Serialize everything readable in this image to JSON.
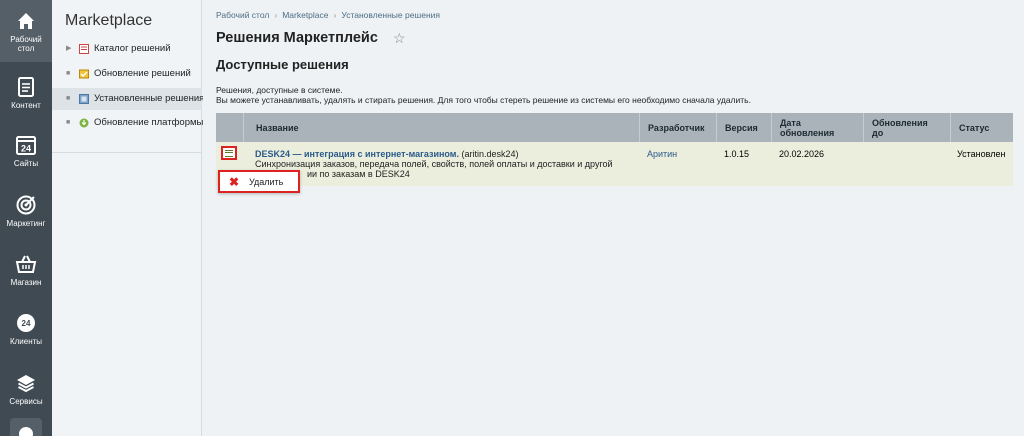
{
  "rail": {
    "items": [
      {
        "label": "Рабочий стол",
        "icon": "home-icon"
      },
      {
        "label": "Контент",
        "icon": "document-icon"
      },
      {
        "label": "Сайты",
        "icon": "calendar-24-icon"
      },
      {
        "label": "Маркетинг",
        "icon": "target-icon"
      },
      {
        "label": "Магазин",
        "icon": "basket-icon"
      },
      {
        "label": "Клиенты",
        "icon": "clients-24-icon"
      },
      {
        "label": "Сервисы",
        "icon": "layers-icon"
      }
    ],
    "icon_24": "24"
  },
  "sidebar": {
    "title": "Marketplace",
    "items": [
      {
        "label": "Каталог решений",
        "icon": "catalog-icon"
      },
      {
        "label": "Обновление решений",
        "icon": "update-icon"
      },
      {
        "label": "Установленные решения",
        "icon": "installed-icon",
        "active": true
      },
      {
        "label": "Обновление платформы",
        "icon": "platform-update-icon"
      }
    ]
  },
  "breadcrumbs": [
    "Рабочий стол",
    "Marketplace",
    "Установленные решения"
  ],
  "page": {
    "title": "Решения Маркетплейс",
    "subtitle": "Доступные решения",
    "desc_line1": "Решения, доступные в системе.",
    "desc_line2": "Вы можете устанавливать, удалять и стирать решения. Для того чтобы стереть решение из системы его необходимо сначала удалить."
  },
  "table": {
    "headers": {
      "name": "Название",
      "developer": "Разработчик",
      "version": "Версия",
      "date_l1": "Дата",
      "date_l2": "обновления",
      "updates_l1": "Обновления",
      "updates_l2": "до",
      "status": "Статус"
    },
    "rows": [
      {
        "name": "DESK24 — интеграция с интернет-магазином.",
        "code": "(aritin.desk24)",
        "desc_line1": "Синхронизация заказов, передача полей, свойств, полей оплаты и доставки и другой",
        "desc_line2": "ии по заказам в DESK24",
        "developer": "Аритин",
        "version": "1.0.15",
        "date": "20.02.2026",
        "updates_until": "",
        "status": "Установлен"
      }
    ]
  },
  "context_menu": {
    "delete_label": "Удалить"
  },
  "colors": {
    "rail_bg": "#3f4a52",
    "header_bg": "#aab3b9",
    "row_bg": "#eceedd",
    "highlight_border": "#dd2222",
    "link": "#2a5b8a"
  }
}
